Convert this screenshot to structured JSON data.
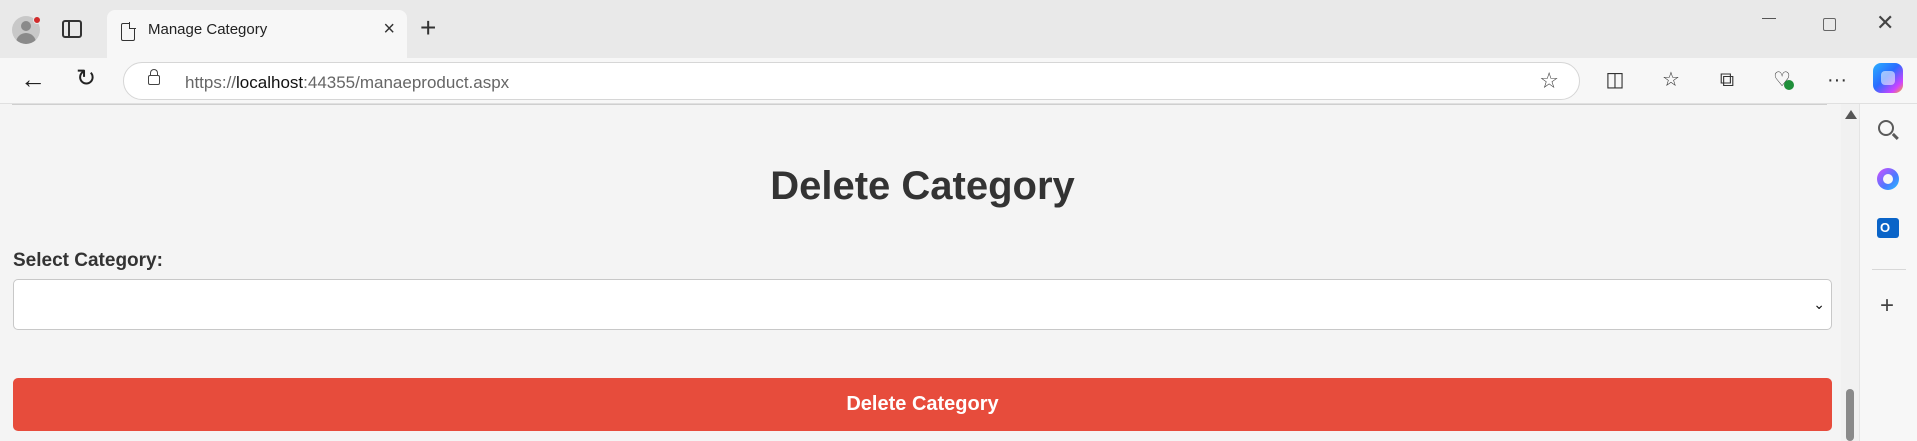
{
  "browser": {
    "tab_title": "Manage Category",
    "close_tab_glyph": "×",
    "new_tab_glyph": "+",
    "url_scheme": "https://",
    "url_host": "localhost",
    "url_rest": ":44355/manaeproduct.aspx",
    "toolbar_icons": [
      "split-screen-icon",
      "favorites-icon",
      "collections-icon",
      "browser-essentials-icon",
      "more-icon",
      "copilot-icon"
    ],
    "sidebar_icons": [
      "search-icon",
      "office-icon",
      "outlook-icon",
      "add-icon"
    ]
  },
  "page": {
    "heading": "Delete Category",
    "select_label": "Select Category:",
    "select_value": "",
    "delete_button_label": "Delete Category"
  },
  "colors": {
    "delete_button": "#e74c3c",
    "heading_text": "#333333",
    "page_background": "#f4f4f4"
  }
}
